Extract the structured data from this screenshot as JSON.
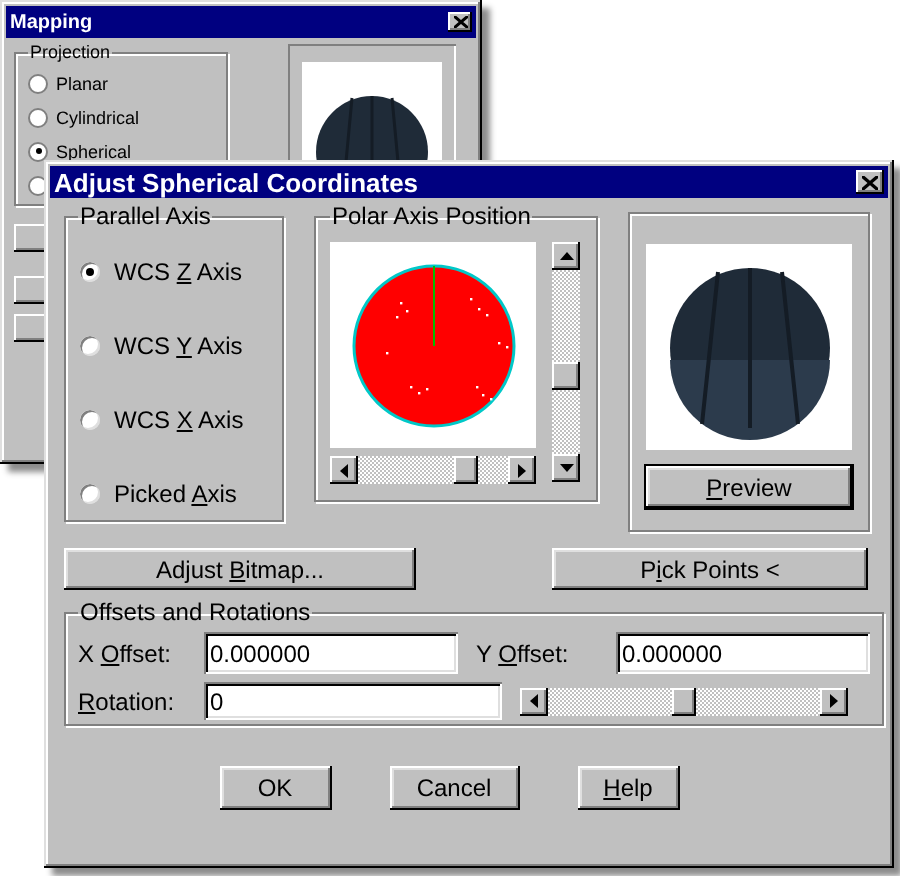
{
  "mapping_window": {
    "title": "Mapping",
    "projection": {
      "title": "Projection",
      "options": [
        {
          "label": "Planar",
          "selected": false
        },
        {
          "label": "Cylindrical",
          "selected": false
        },
        {
          "label": "Spherical",
          "selected": true
        },
        {
          "selected": false
        }
      ]
    }
  },
  "dialog": {
    "title": "Adjust Spherical Coordinates",
    "parallel_axis": {
      "title": "Parallel Axis",
      "options": [
        {
          "label": [
            {
              "text": "WCS ",
              "underlined": false
            },
            {
              "text": "Z",
              "underlined": true
            },
            {
              "text": " Axis",
              "underlined": false
            }
          ],
          "selected": true
        },
        {
          "label": [
            {
              "text": "WCS ",
              "underlined": false
            },
            {
              "text": "Y",
              "underlined": true
            },
            {
              "text": " Axis",
              "underlined": false
            }
          ],
          "selected": false
        },
        {
          "label": [
            {
              "text": "WCS ",
              "underlined": false
            },
            {
              "text": "X",
              "underlined": true
            },
            {
              "text": " Axis",
              "underlined": false
            }
          ],
          "selected": false
        },
        {
          "label": [
            {
              "text": "Picked ",
              "underlined": false
            },
            {
              "text": "A",
              "underlined": true
            },
            {
              "text": "xis",
              "underlined": false
            }
          ],
          "selected": false
        }
      ]
    },
    "polar_axis_position": {
      "title": "Polar Axis Position"
    },
    "preview_button": [
      {
        "text": "P",
        "underlined": true
      },
      {
        "text": "review",
        "underlined": false
      }
    ],
    "adjust_bitmap_button": [
      {
        "text": "Adjust ",
        "underlined": false
      },
      {
        "text": "B",
        "underlined": true
      },
      {
        "text": "itmap...",
        "underlined": false
      }
    ],
    "pick_points_button": [
      {
        "text": "P",
        "underlined": false
      },
      {
        "text": "i",
        "underlined": true
      },
      {
        "text": "ck Points <",
        "underlined": false
      }
    ],
    "offsets_and_rotations": {
      "title": "Offsets and Rotations",
      "x_offset": {
        "label": [
          {
            "text": "X ",
            "underlined": false
          },
          {
            "text": "O",
            "underlined": true
          },
          {
            "text": "ffset:",
            "underlined": false
          }
        ],
        "value": "0.000000"
      },
      "y_offset": {
        "label": [
          {
            "text": "Y ",
            "underlined": false
          },
          {
            "text": "O",
            "underlined": true
          },
          {
            "text": "ffset:",
            "underlined": false
          }
        ],
        "value": "0.000000"
      },
      "rotation": {
        "label": [
          {
            "text": "R",
            "underlined": true
          },
          {
            "text": "otation:",
            "underlined": false
          }
        ],
        "value": "0"
      },
      "rotation_slider": {
        "level": 0.5
      }
    },
    "buttons": [
      [
        {
          "text": "OK",
          "underlined": false
        }
      ],
      [
        {
          "text": "Cancel",
          "underlined": false
        }
      ],
      [
        {
          "text": "H",
          "underlined": true
        },
        {
          "text": "elp",
          "underlined": false
        }
      ]
    ]
  }
}
